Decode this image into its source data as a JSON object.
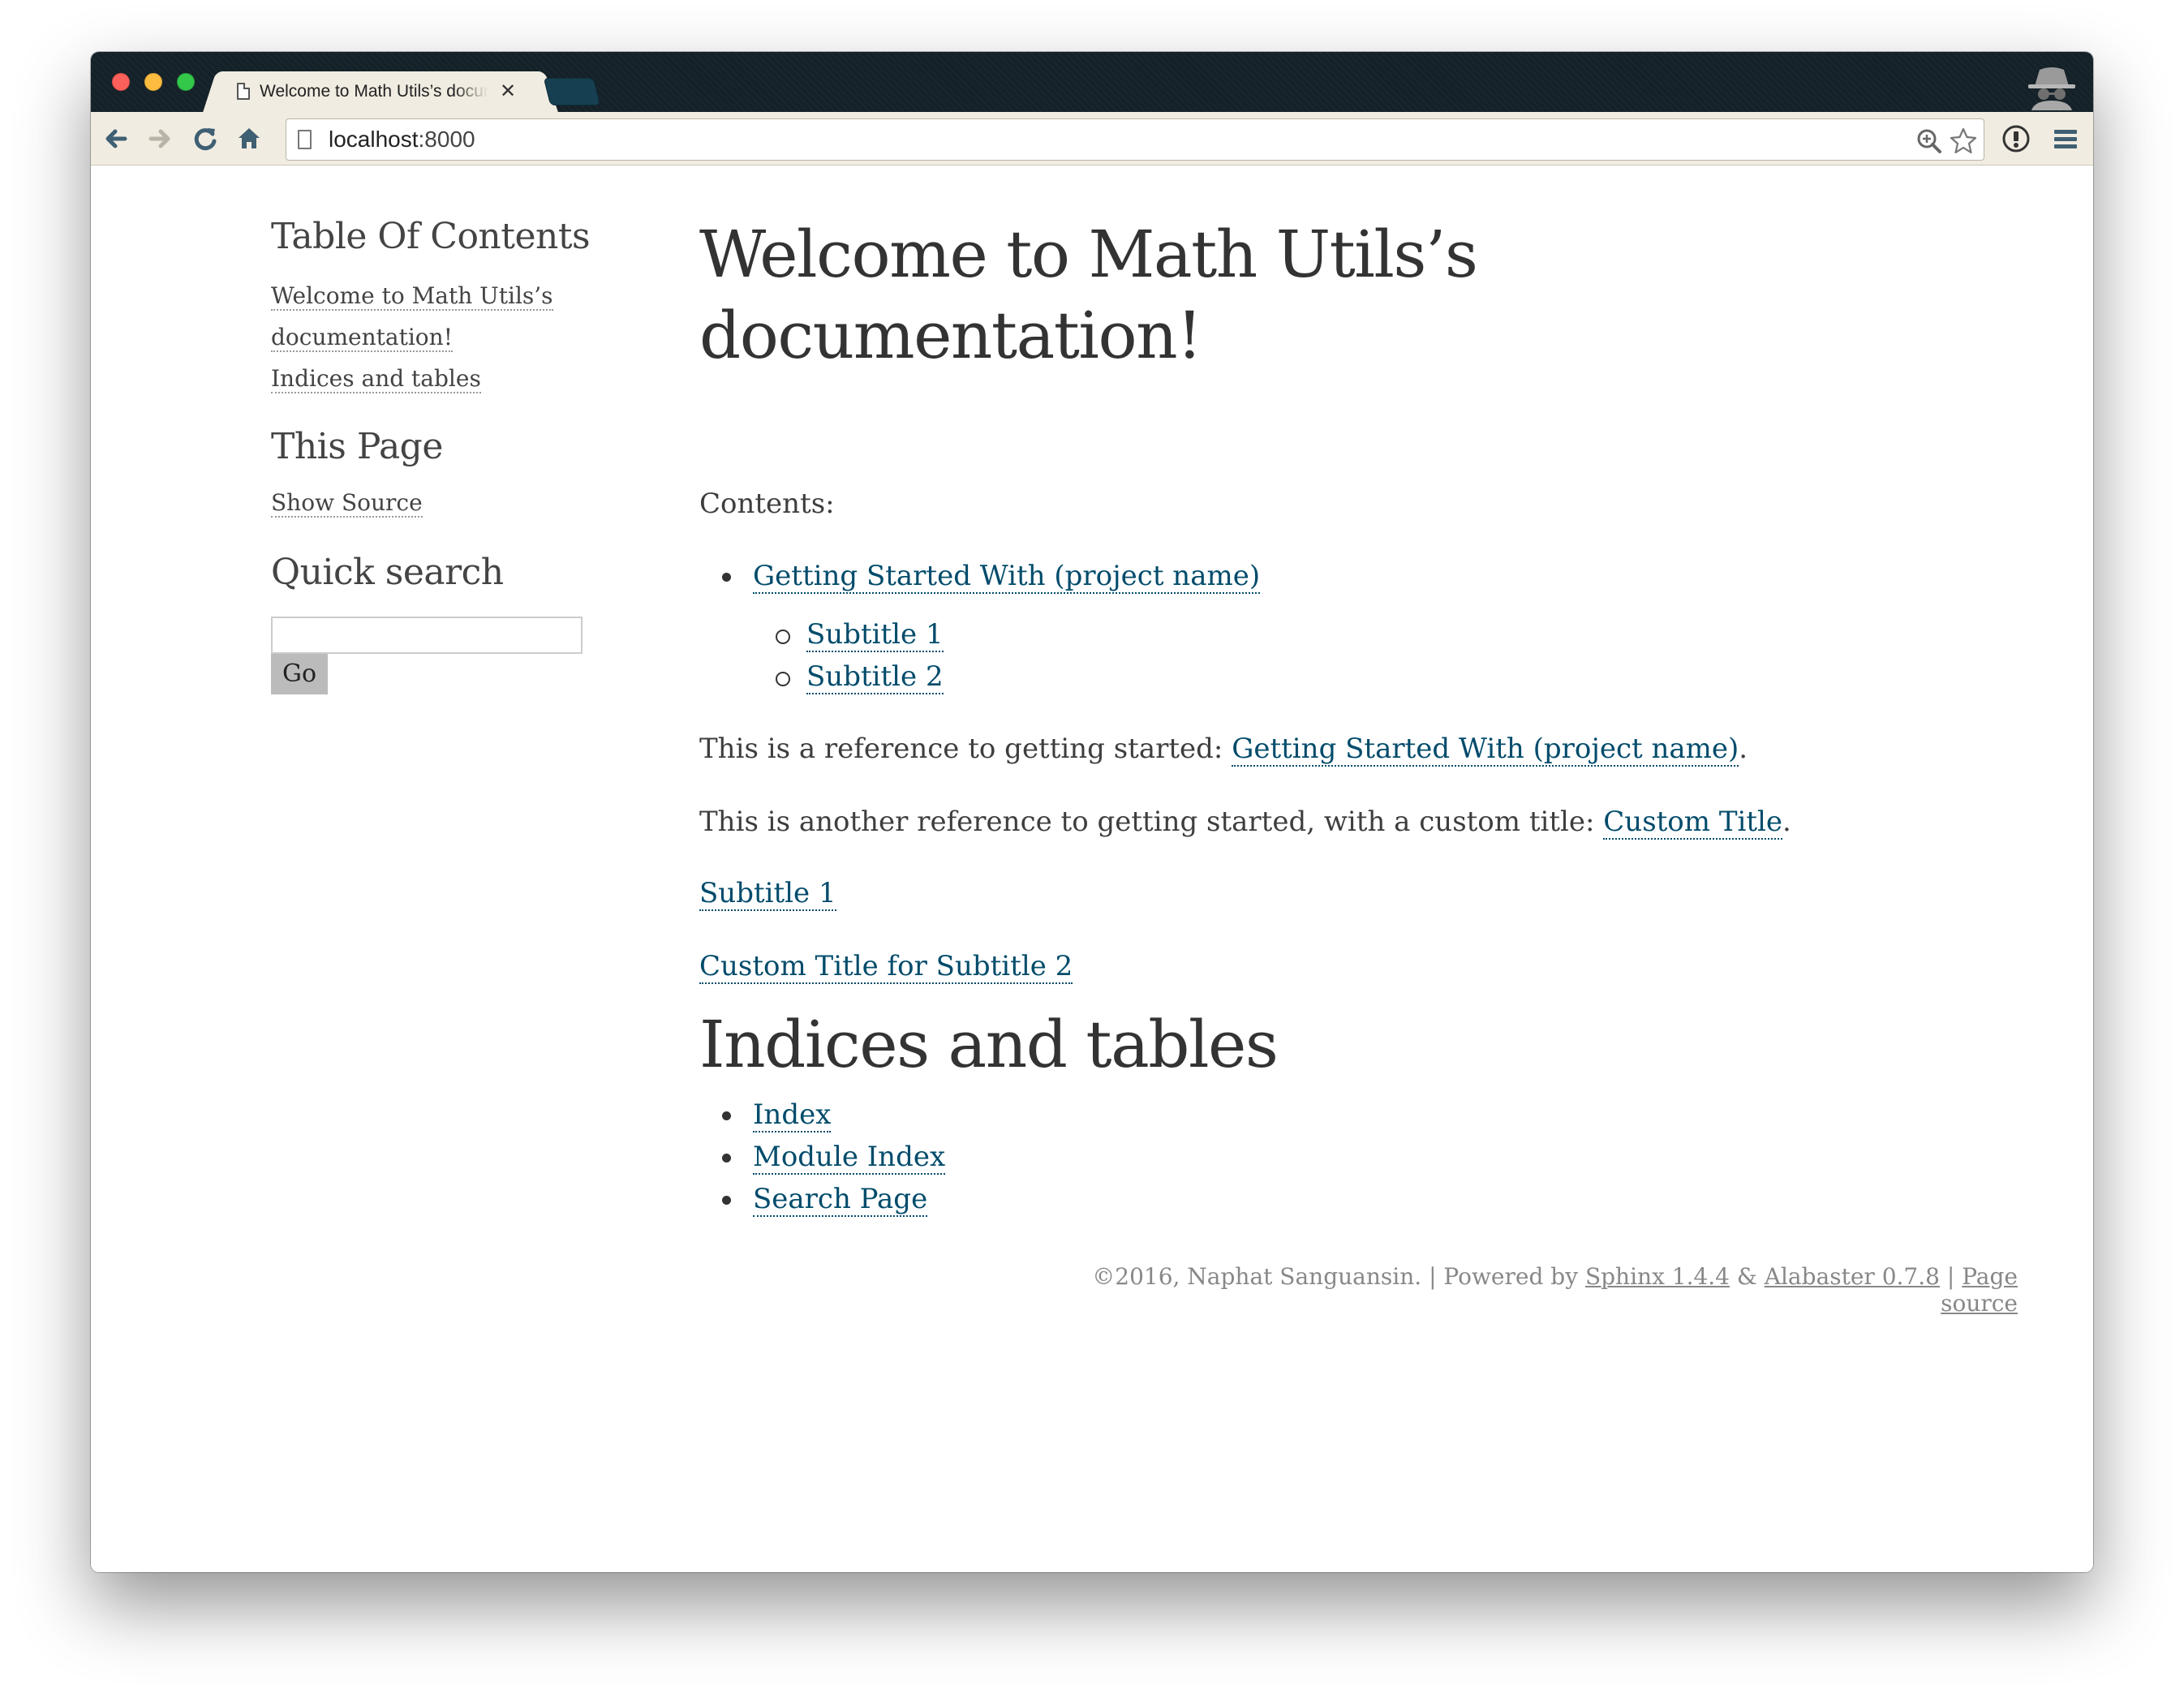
{
  "browser": {
    "tab_title": "Welcome to Math Utils’s documentation!",
    "url_host": "localhost",
    "url_port": ":8000",
    "icons": [
      "back-icon",
      "forward-icon",
      "reload-icon",
      "home-icon",
      "zoom-icon",
      "star-icon",
      "extension-icon",
      "menu-icon",
      "incognito-icon"
    ]
  },
  "sidebar": {
    "toc_heading": "Table Of Contents",
    "toc_items": [
      "Welcome to Math Utils’s",
      "documentation!",
      "Indices and tables"
    ],
    "this_page_heading": "This Page",
    "show_source": "Show Source",
    "search_heading": "Quick search",
    "search_value": "",
    "go_label": "Go"
  },
  "main": {
    "title": "Welcome to Math Utils’s documentation!",
    "contents_label": "Contents:",
    "toc_link": "Getting Started With (project name)",
    "subtitles": [
      "Subtitle 1",
      "Subtitle 2"
    ],
    "ref1_text": "This is a reference to getting started: ",
    "ref1_link": "Getting Started With (project name)",
    "ref1_end": ".",
    "ref2_text": "This is another reference to getting started, with a custom title: ",
    "ref2_link": "Custom Title",
    "ref2_end": ".",
    "subtitle1_link": "Subtitle 1",
    "custom_subtitle2_link": "Custom Title for Subtitle 2",
    "indices_heading": "Indices and tables",
    "indices": [
      "Index",
      "Module Index",
      "Search Page"
    ]
  },
  "footer": {
    "copyright": "©2016, Naphat Sanguansin.",
    "sep": "|",
    "powered_by": "Powered by ",
    "sphinx": "Sphinx 1.4.4",
    "amp": "&",
    "alabaster": "Alabaster 0.7.8",
    "page_source": "Page source"
  },
  "colors": {
    "link": "#004b6b",
    "text": "#3e3e3e",
    "titlebar": "#142128",
    "toolbar": "#f1ece1"
  }
}
